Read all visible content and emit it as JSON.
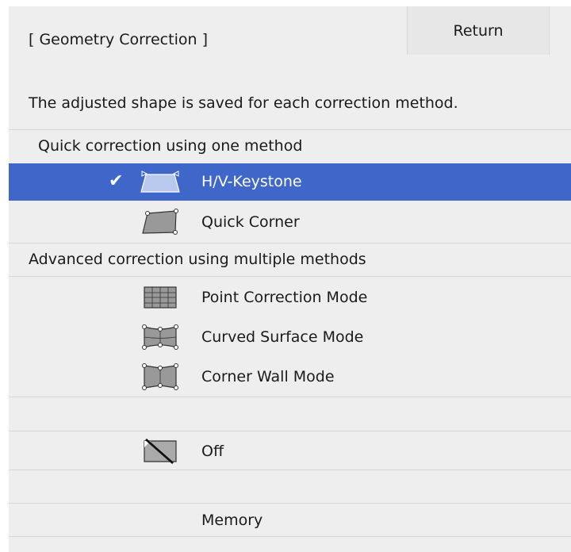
{
  "header": {
    "title": "[ Geometry Correction ]",
    "return_label": "Return"
  },
  "description": "The adjusted shape is saved for each correction method.",
  "sections": {
    "quick": "Quick correction using one method",
    "advanced": "Advanced correction using multiple methods"
  },
  "items": {
    "hv_keystone": "H/V-Keystone",
    "quick_corner": "Quick Corner",
    "point_correction": "Point Correction Mode",
    "curved_surface": "Curved Surface Mode",
    "corner_wall": "Corner Wall Mode",
    "off": "Off",
    "memory": "Memory"
  },
  "selected_item": "H/V-Keystone",
  "colors": {
    "background": "#eeeeee",
    "selection": "#3e67c9",
    "text": "#1a1a1a"
  },
  "icons": {
    "selected_marker": "checkmark-icon"
  }
}
